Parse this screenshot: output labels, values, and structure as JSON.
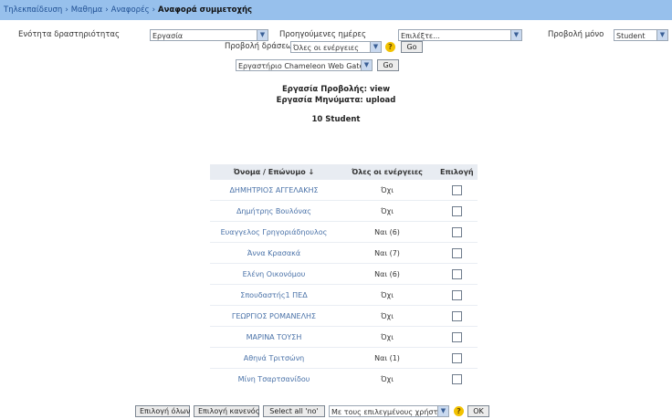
{
  "breadcrumb": {
    "items": [
      "Τηλεκπαίδευση",
      "Μαθημα",
      "Αναφορές"
    ],
    "current": "Αναφορά συμμετοχής"
  },
  "filters": {
    "activity_label": "Ενότητα δραστηριότητας",
    "activity_value": "Εργασία",
    "days_label": "Προηγούμενες ημέρες",
    "days_value": "Επιλέξτε...",
    "role_label": "Προβολή μόνο",
    "role_value": "Student",
    "actions_label": "Προβολή δράσεων",
    "actions_value": "Όλες οι ενέργειες",
    "go_label": "Go",
    "activity2_value": "Εργαστήριο Chameleon Web Gateway",
    "go2_label": "Go"
  },
  "summary": {
    "view_task": "Εργασία Προβολής: view",
    "post_task": "Εργασία Μηνύματα: upload",
    "count": "10 Student"
  },
  "table": {
    "headers": {
      "name": "Όνομα / Επώνυμο ↓",
      "all_actions": "Όλες οι ενέργειες",
      "select": "Επιλογή"
    },
    "rows": [
      {
        "name": "ΔΗΜΗΤΡΙΟΣ ΑΓΓΕΛΑΚΗΣ",
        "actions": "Όχι"
      },
      {
        "name": "Δημήτρης Βουλόνας",
        "actions": "Όχι"
      },
      {
        "name": "Ευαγγελος Γρηγοριάδηουλος",
        "actions": "Ναι (6)"
      },
      {
        "name": "Άννα Κρασακά",
        "actions": "Ναι (7)"
      },
      {
        "name": "Ελένη Οικονόμου",
        "actions": "Ναι (6)"
      },
      {
        "name": "Σπουδαστής1 ΠΕΔ",
        "actions": "Όχι"
      },
      {
        "name": "ΓΕΩΡΓΙΟΣ ΡΟΜΑΝΕΛΗΣ",
        "actions": "Όχι"
      },
      {
        "name": "ΜΑΡΙΝΑ ΤΟΥΣΗ",
        "actions": "Όχι"
      },
      {
        "name": "Αθηνά Τριτσώνη",
        "actions": "Ναι (1)"
      },
      {
        "name": "Μίνη Τσαρτσανίδου",
        "actions": "Όχι"
      }
    ]
  },
  "bottom": {
    "select_all": "Επιλογή όλων",
    "deselect_all": "Επιλογή κανενός",
    "select_no": "Select all 'no'",
    "with_selected": "Με τους επιλεγμένους χρήστες...",
    "ok": "OK"
  }
}
